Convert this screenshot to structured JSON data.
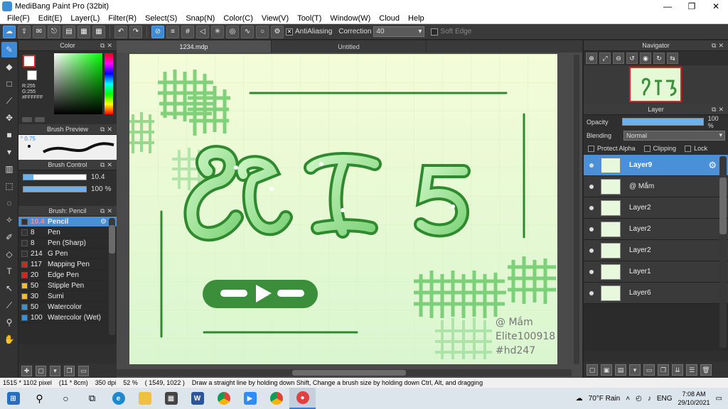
{
  "app": {
    "title": "MediBang Paint Pro (32bit)",
    "window_buttons": [
      "—",
      "❐",
      "✕"
    ]
  },
  "menu": [
    "File(F)",
    "Edit(E)",
    "Layer(L)",
    "Filter(R)",
    "Select(S)",
    "Snap(N)",
    "Color(C)",
    "View(V)",
    "Tool(T)",
    "Window(W)",
    "Cloud",
    "Help"
  ],
  "toolbar": {
    "antialiasing_label": "AntiAliasing",
    "antialiasing_checked": "✕",
    "correction_label": "Correction",
    "correction_value": "40",
    "soft_edge_label": "Soft Edge"
  },
  "color_panel": {
    "title": "Color",
    "r_text": "R:255",
    "g_text": "G:255",
    "hex_text": "#FFFFFF"
  },
  "brush_preview": {
    "title": "Brush Preview",
    "size_text": "0.75"
  },
  "brush_control": {
    "title": "Brush Control",
    "size_value": "10.4",
    "size_fraction": 0.16,
    "opacity_value": "100 %",
    "opacity_fraction": 1.0
  },
  "brush_list": {
    "title": "Brush: Pencil",
    "items": [
      {
        "color": "#333333",
        "size": "10.4",
        "name": "Pencil",
        "active": true
      },
      {
        "color": "#333333",
        "size": "8",
        "name": "Pen"
      },
      {
        "color": "#333333",
        "size": "8",
        "name": "Pen (Sharp)"
      },
      {
        "color": "#333333",
        "size": "214",
        "name": "G Pen"
      },
      {
        "color": "#e02020",
        "size": "117",
        "name": "Mapping Pen"
      },
      {
        "color": "#e02020",
        "size": "20",
        "name": "Edge Pen"
      },
      {
        "color": "#f0c020",
        "size": "50",
        "name": "Stipple Pen"
      },
      {
        "color": "#f0c020",
        "size": "30",
        "name": "Sumi"
      },
      {
        "color": "#3a8fd8",
        "size": "50",
        "name": "Watercolor"
      },
      {
        "color": "#3a8fd8",
        "size": "100",
        "name": "Watercolor (Wet)"
      }
    ]
  },
  "tabs": [
    {
      "label": "1234.mdp",
      "active": true
    },
    {
      "label": "Untitled",
      "active": false
    }
  ],
  "artwork": {
    "main_letters": "ƏCI 5",
    "signature_line1": "@ Mắm",
    "signature_line2": "Elite100918",
    "signature_line3": "#hd247"
  },
  "navigator": {
    "title": "Navigator"
  },
  "layer_panel": {
    "title": "Layer",
    "opacity_label": "Opacity",
    "opacity_value": "100 %",
    "blending_label": "Blending",
    "blending_value": "Normal",
    "protect_alpha_label": "Protect Alpha",
    "clipping_label": "Clipping",
    "lock_label": "Lock",
    "layers": [
      {
        "name": "Layer9",
        "active": true
      },
      {
        "name": "@ Mắm",
        "active": false
      },
      {
        "name": "Layer2",
        "active": false
      },
      {
        "name": "Layer2",
        "active": false
      },
      {
        "name": "Layer2",
        "active": false
      },
      {
        "name": "Layer1",
        "active": false
      },
      {
        "name": "Layer6",
        "active": false
      }
    ]
  },
  "status": {
    "size": "1515 * 1102 pixel",
    "dims": "(11 * 8cm)",
    "dpi": "350 dpi",
    "zoom": "52 %",
    "coords": "( 1549, 1022 )",
    "hint": "Draw a straight line by holding down Shift, Change a brush size by holding down Ctrl, Alt, and dragging"
  },
  "taskbar": {
    "weather": "70°F  Rain",
    "lang": "ENG",
    "time": "7:08 AM",
    "date": "29/10/2021"
  },
  "colors": {
    "accent": "#3d8ad8",
    "canvas_bg": "#eefbe0",
    "ink_dark": "#2f8a2f",
    "ink_light": "#8ed88e"
  }
}
